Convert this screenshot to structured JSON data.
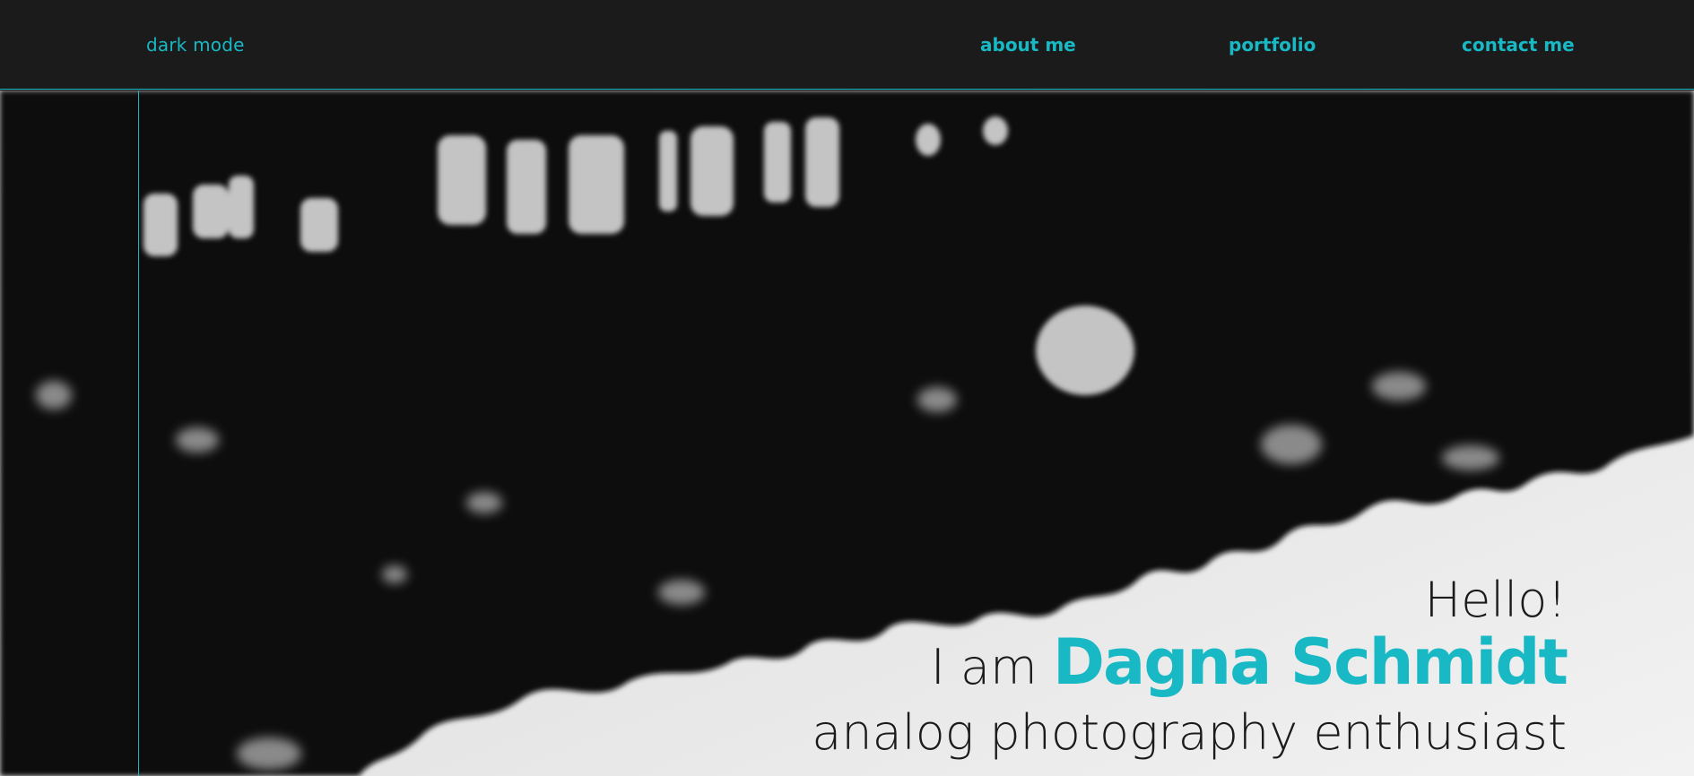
{
  "header": {
    "mode_toggle": "dark mode",
    "nav": [
      {
        "label": "about me"
      },
      {
        "label": "portfolio"
      },
      {
        "label": "contact me"
      }
    ]
  },
  "hero": {
    "greeting": "Hello!",
    "intro_prefix": "I am",
    "name": "Dagna Schmidt",
    "tagline": "analog photography enthusiast",
    "photo": "black-and-white photo of dark tree canopy against bright sky"
  },
  "colors": {
    "accent": "#18b9c4",
    "header_bg": "#1b1b1b",
    "hero_text": "#1b1b1b"
  }
}
